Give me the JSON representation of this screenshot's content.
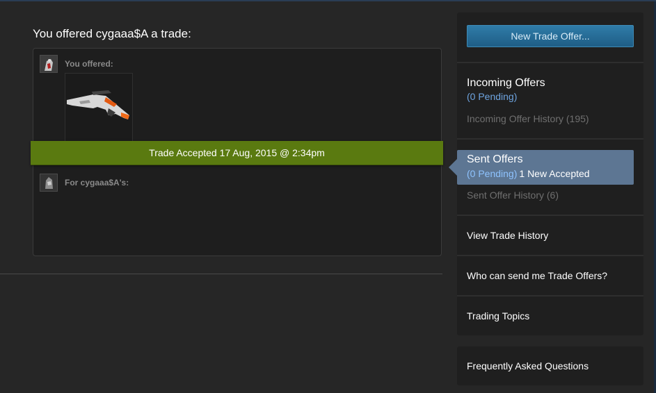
{
  "offer": {
    "title": "You offered cygaaa$A a trade:",
    "you_offered_label": "You offered:",
    "for_label": "For cygaaa$A's:",
    "accepted_banner": "Trade Accepted 17 Aug, 2015 @ 2:34pm"
  },
  "sidebar": {
    "new_offer_button": "New Trade Offer...",
    "incoming": {
      "title": "Incoming Offers",
      "pending": "(0 Pending)",
      "history": "Incoming Offer History (195)"
    },
    "sent": {
      "title": "Sent Offers",
      "pending": "(0 Pending)",
      "accepted": "1 New Accepted",
      "history": "Sent Offer History (6)"
    },
    "links": {
      "view_history": "View Trade History",
      "who_can_send": "Who can send me Trade Offers?",
      "trading_topics": "Trading Topics",
      "faq": "Frequently Asked Questions"
    }
  },
  "icons": {
    "my_avatar": "user-avatar-icon",
    "partner_avatar": "partner-avatar-icon",
    "item": "rifle-item-icon"
  },
  "colors": {
    "accepted_green": "#5a7a10",
    "active_blue": "#5d7693",
    "pending_blue": "#6ea4e0",
    "button_blue": "#2f7ca8"
  }
}
